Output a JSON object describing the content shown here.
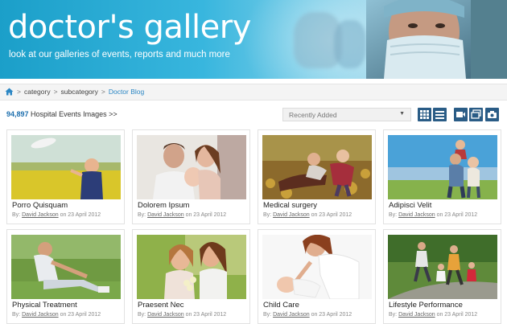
{
  "header": {
    "title": "doctor's gallery",
    "subtitle": "look at our galleries of events, reports and much more"
  },
  "breadcrumb": {
    "home_icon": "home-icon",
    "items": [
      "category",
      "subcategory",
      "Doctor Blog"
    ],
    "separator": ">"
  },
  "toolbar": {
    "count": "94,897",
    "count_label": "Hospital Events Images",
    "count_arrow": ">>",
    "sort_selected": "Recently Added",
    "view_icons": [
      "grid-view-icon",
      "list-view-icon"
    ],
    "media_icons": [
      "video-icon",
      "slideshow-icon",
      "camera-icon"
    ]
  },
  "gallery": [
    {
      "title": "Porro Quisquam",
      "by": "By:",
      "author": "David Jackson",
      "date_text": "on 23 April 2012"
    },
    {
      "title": "Dolorem Ipsum",
      "by": "By:",
      "author": "David Jackson",
      "date_text": "on 23 April 2012"
    },
    {
      "title": "Medical surgery",
      "by": "By:",
      "author": "David Jackson",
      "date_text": "on 23 April 2012"
    },
    {
      "title": "Adipisci Velit",
      "by": "By:",
      "author": "David Jackson",
      "date_text": "on 23 April 2012"
    },
    {
      "title": "Physical Treatment",
      "by": "By:",
      "author": "David Jackson",
      "date_text": "on 23 April 2012"
    },
    {
      "title": "Praesent Nec",
      "by": "By:",
      "author": "David Jackson",
      "date_text": "on 23 April 2012"
    },
    {
      "title": "Child Care",
      "by": "By:",
      "author": "David Jackson",
      "date_text": "on 23 April 2012"
    },
    {
      "title": "Lifestyle Performance",
      "by": "By:",
      "author": "David Jackson",
      "date_text": "on 23 April 2012"
    }
  ],
  "colors": {
    "brand_blue": "#1b9fc9",
    "link_blue": "#2c87c4",
    "icon_button": "#2a5c86"
  }
}
